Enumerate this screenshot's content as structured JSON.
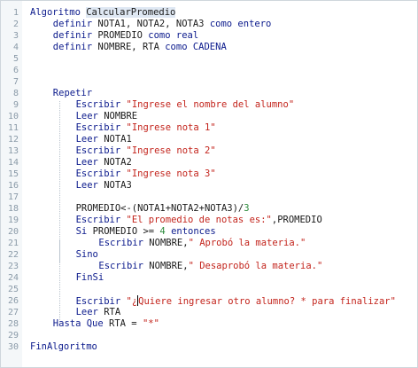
{
  "editor": {
    "lines": [
      {
        "n": "1",
        "indent": 0,
        "tokens": [
          {
            "t": "kw",
            "v": "Algoritmo "
          },
          {
            "t": "id hl",
            "v": "CalcularPromedio"
          }
        ]
      },
      {
        "n": "2",
        "indent": 4,
        "tokens": [
          {
            "t": "kw",
            "v": "definir "
          },
          {
            "t": "id",
            "v": "NOTA1, NOTA2, NOTA3 "
          },
          {
            "t": "kw",
            "v": "como entero"
          }
        ]
      },
      {
        "n": "3",
        "indent": 4,
        "tokens": [
          {
            "t": "kw",
            "v": "definir "
          },
          {
            "t": "id",
            "v": "PROMEDIO "
          },
          {
            "t": "kw",
            "v": "como real"
          }
        ]
      },
      {
        "n": "4",
        "indent": 4,
        "tokens": [
          {
            "t": "kw",
            "v": "definir "
          },
          {
            "t": "id",
            "v": "NOMBRE, RTA "
          },
          {
            "t": "kw",
            "v": "como CADENA"
          }
        ]
      },
      {
        "n": "5",
        "indent": 0,
        "tokens": []
      },
      {
        "n": "6",
        "indent": 0,
        "tokens": []
      },
      {
        "n": "7",
        "indent": 0,
        "tokens": []
      },
      {
        "n": "8",
        "indent": 4,
        "tokens": [
          {
            "t": "kw",
            "v": "Repetir"
          }
        ]
      },
      {
        "n": "9",
        "indent": 8,
        "tokens": [
          {
            "t": "kw",
            "v": "Escribir "
          },
          {
            "t": "st",
            "v": "\"Ingrese el nombre del alumno\""
          }
        ]
      },
      {
        "n": "10",
        "indent": 8,
        "tokens": [
          {
            "t": "kw",
            "v": "Leer "
          },
          {
            "t": "id",
            "v": "NOMBRE"
          }
        ]
      },
      {
        "n": "11",
        "indent": 8,
        "tokens": [
          {
            "t": "kw",
            "v": "Escribir "
          },
          {
            "t": "st",
            "v": "\"Ingrese nota 1\""
          }
        ]
      },
      {
        "n": "12",
        "indent": 8,
        "tokens": [
          {
            "t": "kw",
            "v": "Leer "
          },
          {
            "t": "id",
            "v": "NOTA1"
          }
        ]
      },
      {
        "n": "13",
        "indent": 8,
        "tokens": [
          {
            "t": "kw",
            "v": "Escribir "
          },
          {
            "t": "st",
            "v": "\"Ingrese nota 2\""
          }
        ]
      },
      {
        "n": "14",
        "indent": 8,
        "tokens": [
          {
            "t": "kw",
            "v": "Leer "
          },
          {
            "t": "id",
            "v": "NOTA2"
          }
        ]
      },
      {
        "n": "15",
        "indent": 8,
        "tokens": [
          {
            "t": "kw",
            "v": "Escribir "
          },
          {
            "t": "st",
            "v": "\"Ingrese nota 3\""
          }
        ]
      },
      {
        "n": "16",
        "indent": 8,
        "tokens": [
          {
            "t": "kw",
            "v": "Leer "
          },
          {
            "t": "id",
            "v": "NOTA3"
          }
        ]
      },
      {
        "n": "17",
        "indent": 0,
        "tokens": []
      },
      {
        "n": "18",
        "indent": 8,
        "tokens": [
          {
            "t": "id",
            "v": "PROMEDIO<-(NOTA1+NOTA2+NOTA3)/"
          },
          {
            "t": "nm",
            "v": "3"
          }
        ]
      },
      {
        "n": "19",
        "indent": 8,
        "tokens": [
          {
            "t": "kw",
            "v": "Escribir "
          },
          {
            "t": "st",
            "v": "\"El promedio de notas es:\""
          },
          {
            "t": "id",
            "v": ",PROMEDIO"
          }
        ]
      },
      {
        "n": "20",
        "indent": 8,
        "tokens": [
          {
            "t": "kw",
            "v": "Si "
          },
          {
            "t": "id",
            "v": "PROMEDIO >= "
          },
          {
            "t": "nm",
            "v": "4"
          },
          {
            "t": "kw",
            "v": " entonces"
          }
        ]
      },
      {
        "n": "21",
        "indent": 12,
        "tokens": [
          {
            "t": "kw",
            "v": "Escribir "
          },
          {
            "t": "id",
            "v": "NOMBRE,"
          },
          {
            "t": "st",
            "v": "\" Aprobó la materia.\""
          }
        ]
      },
      {
        "n": "22",
        "indent": 8,
        "tokens": [
          {
            "t": "kw",
            "v": "Sino"
          }
        ]
      },
      {
        "n": "23",
        "indent": 12,
        "tokens": [
          {
            "t": "kw",
            "v": "Escribir "
          },
          {
            "t": "id",
            "v": "NOMBRE,"
          },
          {
            "t": "st",
            "v": "\" Desaprobó la materia.\""
          }
        ]
      },
      {
        "n": "24",
        "indent": 8,
        "tokens": [
          {
            "t": "kw",
            "v": "FinSi"
          }
        ]
      },
      {
        "n": "25",
        "indent": 0,
        "tokens": []
      },
      {
        "n": "26",
        "indent": 8,
        "tokens": [
          {
            "t": "kw",
            "v": "Escribir "
          },
          {
            "t": "st",
            "v": "\"¿"
          },
          {
            "t": "caret",
            "v": ""
          },
          {
            "t": "st",
            "v": "Quiere ingresar otro alumno? * para finalizar\""
          }
        ]
      },
      {
        "n": "27",
        "indent": 8,
        "tokens": [
          {
            "t": "kw",
            "v": "Leer "
          },
          {
            "t": "id",
            "v": "RTA"
          }
        ]
      },
      {
        "n": "28",
        "indent": 4,
        "tokens": [
          {
            "t": "kw",
            "v": "Hasta Que "
          },
          {
            "t": "id",
            "v": "RTA = "
          },
          {
            "t": "st",
            "v": "\"*\""
          }
        ]
      },
      {
        "n": "29",
        "indent": 0,
        "tokens": []
      },
      {
        "n": "30",
        "indent": 0,
        "tokens": [
          {
            "t": "kw",
            "v": "FinAlgoritmo"
          }
        ]
      }
    ]
  },
  "colors": {
    "keyword": "#0b1a8c",
    "string": "#c3241c",
    "number": "#2a8a3a",
    "line_number": "#8a9aa8",
    "gutter_background": "#f4f7f9",
    "highlight": "#dfe8f3"
  }
}
